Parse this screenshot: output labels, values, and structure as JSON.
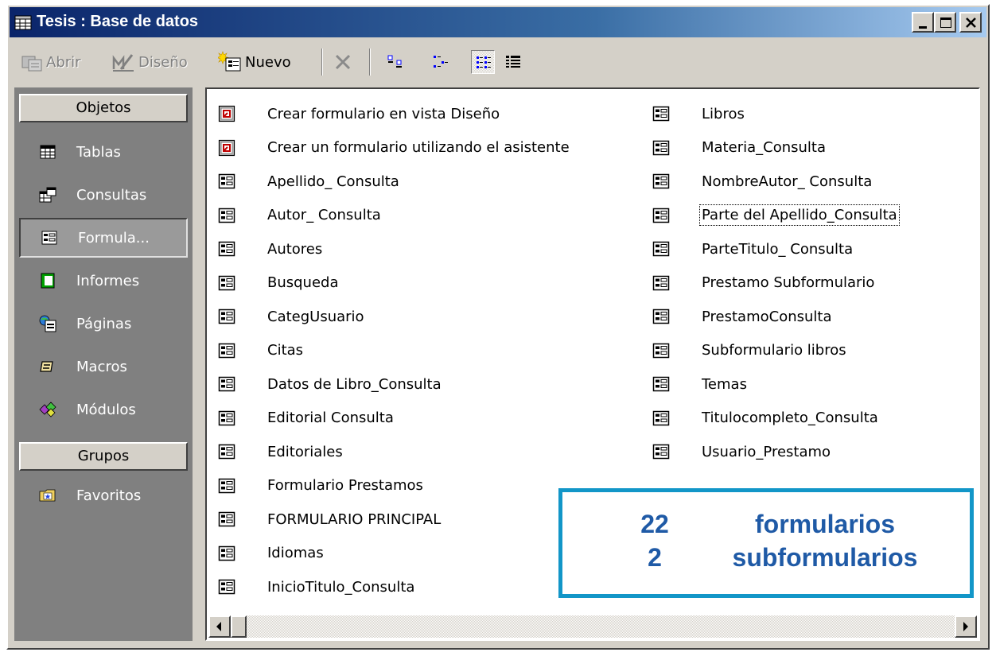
{
  "window": {
    "title": "Tesis : Base de datos",
    "controls": {
      "minimize": "minimize-icon",
      "maximize": "maximize-icon",
      "close": "close-icon"
    }
  },
  "toolbar": {
    "open_label": "Abrir",
    "design_label": "Diseño",
    "new_label": "Nuevo",
    "view_buttons": [
      "large-icons",
      "small-icons",
      "list",
      "details"
    ],
    "selected_view": "list"
  },
  "sidebar": {
    "objects_header": "Objetos",
    "items": [
      {
        "label": "Tablas",
        "icon": "table-icon"
      },
      {
        "label": "Consultas",
        "icon": "query-icon"
      },
      {
        "label": "Formula...",
        "icon": "form-icon",
        "selected": true
      },
      {
        "label": "Informes",
        "icon": "report-icon"
      },
      {
        "label": "Páginas",
        "icon": "page-icon"
      },
      {
        "label": "Macros",
        "icon": "macro-icon"
      },
      {
        "label": "Módulos",
        "icon": "module-icon"
      }
    ],
    "groups_header": "Grupos",
    "groups": [
      {
        "label": "Favoritos",
        "icon": "favorites-folder-icon"
      }
    ]
  },
  "list": {
    "column1": [
      {
        "label": "Crear formulario en vista Diseño",
        "icon": "wizard-icon"
      },
      {
        "label": "Crear un formulario utilizando el asistente",
        "icon": "wizard-icon"
      },
      {
        "label": "Apellido_ Consulta",
        "icon": "form-icon"
      },
      {
        "label": "Autor_ Consulta",
        "icon": "form-icon"
      },
      {
        "label": "Autores",
        "icon": "form-icon"
      },
      {
        "label": "Busqueda",
        "icon": "form-icon"
      },
      {
        "label": "CategUsuario",
        "icon": "form-icon"
      },
      {
        "label": "Citas",
        "icon": "form-icon"
      },
      {
        "label": "Datos de Libro_Consulta",
        "icon": "form-icon"
      },
      {
        "label": "Editorial Consulta",
        "icon": "form-icon"
      },
      {
        "label": "Editoriales",
        "icon": "form-icon"
      },
      {
        "label": "Formulario Prestamos",
        "icon": "form-icon"
      },
      {
        "label": "FORMULARIO PRINCIPAL",
        "icon": "form-icon"
      },
      {
        "label": "Idiomas",
        "icon": "form-icon"
      },
      {
        "label": "InicioTitulo_Consulta",
        "icon": "form-icon"
      }
    ],
    "column2": [
      {
        "label": "Libros",
        "icon": "form-icon"
      },
      {
        "label": "Materia_Consulta",
        "icon": "form-icon"
      },
      {
        "label": "NombreAutor_ Consulta",
        "icon": "form-icon"
      },
      {
        "label": "Parte del Apellido_Consulta",
        "icon": "form-icon",
        "focused": true
      },
      {
        "label": "ParteTitulo_ Consulta",
        "icon": "form-icon"
      },
      {
        "label": "Prestamo Subformulario",
        "icon": "form-icon"
      },
      {
        "label": "PrestamoConsulta",
        "icon": "form-icon"
      },
      {
        "label": "Subformulario libros",
        "icon": "form-icon"
      },
      {
        "label": "Temas",
        "icon": "form-icon"
      },
      {
        "label": "Titulocompleto_Consulta",
        "icon": "form-icon"
      },
      {
        "label": "Usuario_Prestamo",
        "icon": "form-icon"
      }
    ]
  },
  "scrollbar": {
    "left": "scroll-left-icon",
    "right": "scroll-right-icon"
  },
  "callout": {
    "forms_count": "22",
    "forms_label": "formularios",
    "subforms_count": "2",
    "subforms_label": "subformularios",
    "border_color": "#1296c8",
    "text_color": "#1f5aa6"
  }
}
